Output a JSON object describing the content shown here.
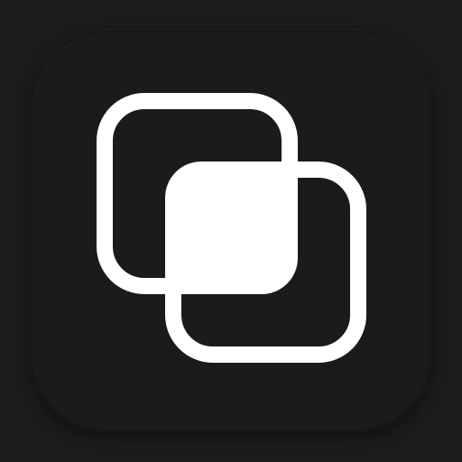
{
  "app_icon": {
    "icon_name": "overlapping-squares-icon",
    "colors": {
      "background": "#1c1c1e",
      "tile": "#1b1b1d",
      "glyph": "#ffffff"
    }
  }
}
